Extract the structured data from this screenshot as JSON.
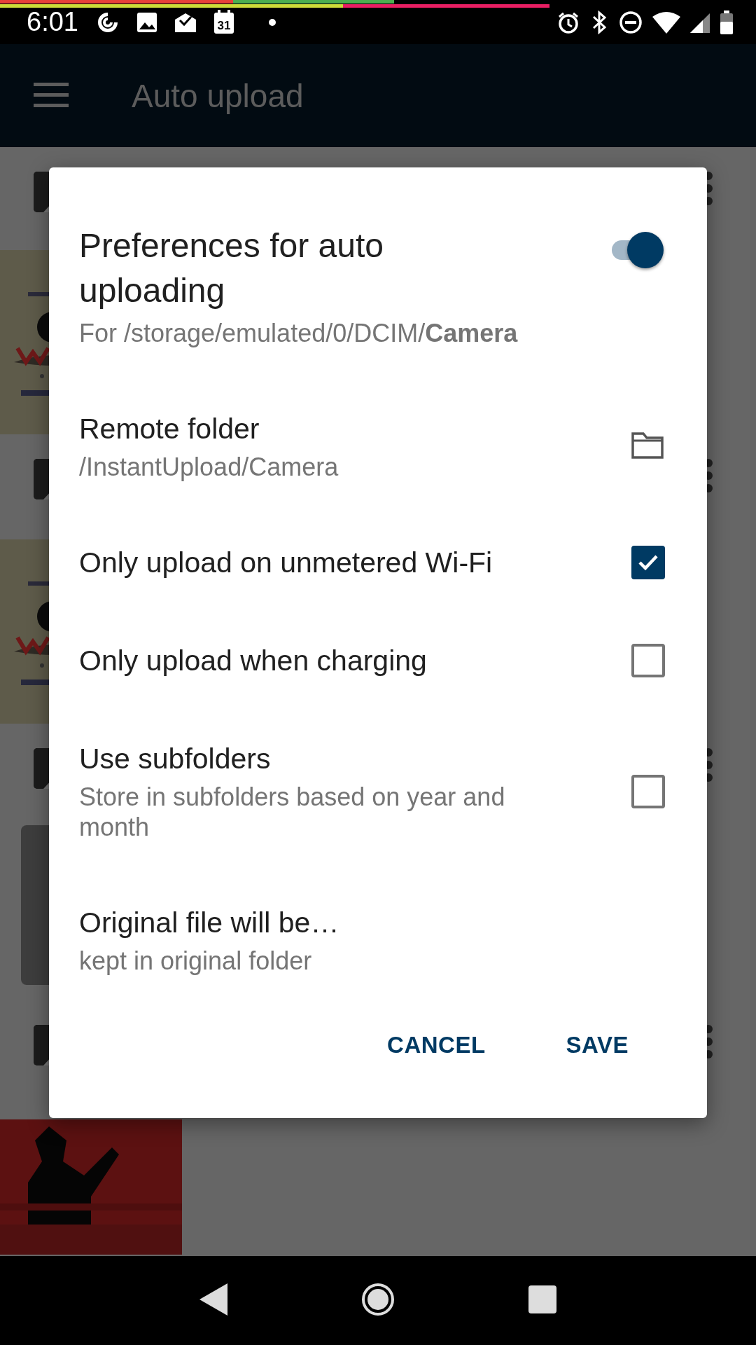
{
  "status_bar": {
    "time": "6:01",
    "calendar_day": "31"
  },
  "app_bar": {
    "title": "Auto upload"
  },
  "background_list": {
    "items": [
      {
        "kind": "row"
      },
      {
        "kind": "picture"
      },
      {
        "kind": "row"
      },
      {
        "kind": "picture"
      },
      {
        "kind": "row"
      },
      {
        "kind": "row"
      },
      {
        "kind": "picture"
      }
    ]
  },
  "dialog": {
    "title": "Preferences for auto uploading",
    "enabled": true,
    "subtitle": "For /storage/emulated/0/DCIM/**Camera**",
    "rows": [
      {
        "kind": "folder",
        "title": "Remote folder",
        "summary": "/InstantUpload/Camera"
      },
      {
        "kind": "checkbox",
        "title": "Only upload on unmetered Wi-Fi",
        "checked": true
      },
      {
        "kind": "checkbox",
        "title": "Only upload when charging",
        "checked": false
      },
      {
        "kind": "checkbox",
        "title": "Use subfolders",
        "summary": "Store in subfolders based on year and month",
        "checked": false
      },
      {
        "kind": "text",
        "title": "Original file will be…",
        "summary": "kept in original folder"
      }
    ],
    "buttons": [
      "CANCEL",
      "SAVE"
    ]
  }
}
